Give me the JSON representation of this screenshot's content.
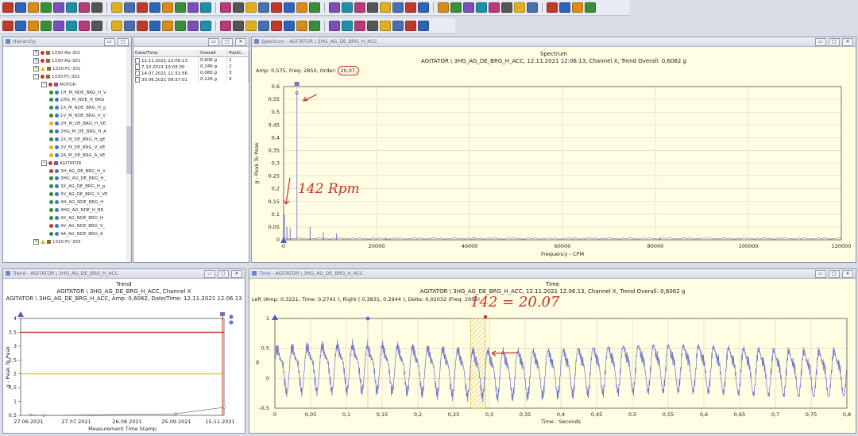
{
  "toolbar_icons_row1": [
    "app-icon",
    "open-icon",
    "save-icon",
    "print-icon",
    "chart-icon",
    "database-icon",
    "tools-icon",
    "report-icon",
    "export-icon",
    "settings-icon",
    "zoom-in-icon",
    "zoom-out-icon",
    "home-icon",
    "hand-icon",
    "target-icon"
  ],
  "toolbar_icons_row2": [
    "layout-icon",
    "grid-icon",
    "filter-icon",
    "cursor-icon",
    "spectrum-icon",
    "waveform-icon",
    "trend-icon",
    "orbit-icon",
    "bode-icon",
    "table-icon",
    "search-icon",
    "play-icon"
  ],
  "hierarchy": {
    "title": "Hierarchy",
    "nodes": [
      {
        "label": "1330-AG-301",
        "indent": 0,
        "status": "red",
        "kind": "machine"
      },
      {
        "label": "1330-AG-302",
        "indent": 0,
        "status": "red",
        "kind": "machine"
      },
      {
        "label": "1330-FC-301",
        "indent": 0,
        "status": "yellow",
        "kind": "machine"
      },
      {
        "label": "1330-FC-302",
        "indent": 0,
        "status": "red",
        "kind": "machine"
      },
      {
        "label": "MOTOR",
        "indent": 1,
        "status": "red",
        "kind": "component"
      },
      {
        "label": "1H_M_NDE_BRG_H_V",
        "indent": 2,
        "status": "green",
        "kind": "point"
      },
      {
        "label": "1HG_M_NDE_H_BRG",
        "indent": 2,
        "status": "green",
        "kind": "point"
      },
      {
        "label": "1X_M_NDE_BRG_H_g",
        "indent": 2,
        "status": "green",
        "kind": "point"
      },
      {
        "label": "1V_M_NDE_BRG_V_V",
        "indent": 2,
        "status": "green",
        "kind": "point"
      },
      {
        "label": "2H_M_DE_BRG_H_VE",
        "indent": 2,
        "status": "yellow",
        "kind": "point"
      },
      {
        "label": "2HG_M_DE_BRG_H_A",
        "indent": 2,
        "status": "green",
        "kind": "point"
      },
      {
        "label": "2X_M_DE_BRG_H_gE",
        "indent": 2,
        "status": "green",
        "kind": "point"
      },
      {
        "label": "2V_M_DE_BRG_V_VE",
        "indent": 2,
        "status": "yellow",
        "kind": "point"
      },
      {
        "label": "2A_M_DE_BRG_A_VE",
        "indent": 2,
        "status": "yellow",
        "kind": "point"
      },
      {
        "label": "AGITATOR",
        "indent": 1,
        "status": "red",
        "kind": "component"
      },
      {
        "label": "3H_AG_DE_BRG_H_V",
        "indent": 2,
        "status": "red",
        "kind": "point"
      },
      {
        "label": "3HG_AG_DE_BRG_H_",
        "indent": 2,
        "status": "green",
        "kind": "point"
      },
      {
        "label": "3X_AG_DE_BRG_H_g",
        "indent": 2,
        "status": "green",
        "kind": "point"
      },
      {
        "label": "3V_AG_DE_BRG_V_VE",
        "indent": 2,
        "status": "green",
        "kind": "point"
      },
      {
        "label": "4H_AG_NDE_BRG_H",
        "indent": 2,
        "status": "green",
        "kind": "point"
      },
      {
        "label": "4HG_AG_NDE_H_BR",
        "indent": 2,
        "status": "green",
        "kind": "point"
      },
      {
        "label": "4X_AG_NDE_BRG_H",
        "indent": 2,
        "status": "green",
        "kind": "point"
      },
      {
        "label": "4V_AG_NDE_BRG_V_",
        "indent": 2,
        "status": "red",
        "kind": "point"
      },
      {
        "label": "4A_AG_NDE_BRG_A",
        "indent": 2,
        "status": "green",
        "kind": "point"
      },
      {
        "label": "1330-FC-303",
        "indent": 0,
        "status": "yellow",
        "kind": "machine"
      }
    ]
  },
  "measurements": {
    "headers": [
      "Date/Time",
      "Overall",
      "Positi..."
    ],
    "rows": [
      {
        "date": "12.11.2021 12:06:13",
        "overall": "0,606 g",
        "pos": "1"
      },
      {
        "date": "7.10.2021 10:03:30",
        "overall": "0,246 g",
        "pos": "2"
      },
      {
        "date": "14.07.2021 11:31:56",
        "overall": "0,080 g",
        "pos": "3"
      },
      {
        "date": "30.06.2021 09:37:01",
        "overall": "0,126 g",
        "pos": "4"
      }
    ]
  },
  "spectrum": {
    "window_title": "Spectrum - AGITATOR \\ 3HG_AG_DE_BRG_H_ACC",
    "title": "Spectrum",
    "subtitle": "AGITATOR \\ 3HG_AG_DE_BRG_H_ACC, 12.11.2021 12:06:13, Channel X, Trend Overall: 0,6062 g",
    "cursor_readout_prefix": "Amp: 0,575, Freq: 2850, Order:",
    "cursor_readout_order": "20,07,",
    "ylabel": "g - Peak To Peak",
    "xlabel": "Frequency - CPM",
    "annotation": "142 Rpm"
  },
  "trend": {
    "window_title": "Trend - AGITATOR \\ 3HG_AG_DE_BRG_H_ACC",
    "title": "Trend",
    "subtitle": "AGITATOR \\ 3HG_AG_DE_BRG_H_ACC, Channel X",
    "subtitle2": "AGITATOR \\ 3HG_AG_DE_BRG_H_ACC, Amp: 0,6062, Date/Time: 12.11.2021 12.06.13",
    "ylabel": "g - Peak To Peak",
    "xlabel": "Measurement Time Stamp"
  },
  "time": {
    "window_title": "Time - AGITATOR \\ 3HG_AG_DE_BRG_H_ACC",
    "title": "Time",
    "subtitle": "AGITATOR \\ 3HG_AG_DE_BRG_H_ACC, 12.11.2021 12.06.13, Channel X, Trend Overall: 0,6062 g",
    "cursor_readout": "Left (Amp: 0,3221, Time: 0,2741 ), Right ( 0,3831, 0,2944 ), Delta: 0,02032 (Freq: 2953)",
    "ylabel": "g",
    "xlabel": "Time - Seconds",
    "annotation": "142 = 20.07"
  },
  "chart_data": [
    {
      "type": "line",
      "name": "spectrum",
      "xlabel": "Frequency - CPM",
      "ylabel": "g - Peak To Peak",
      "xlim": [
        0,
        120000
      ],
      "ylim": [
        0,
        0.6
      ],
      "xticks": [
        "0",
        "20000",
        "40000",
        "60000",
        "80000",
        "100000",
        "120000"
      ],
      "yticks": [
        "0",
        "0,05",
        "0,1",
        "0,15",
        "0,2",
        "0,25",
        "0,3",
        "0,35",
        "0,4",
        "0,45",
        "0,5",
        "0,55",
        "0,6"
      ],
      "peaks": [
        {
          "x": 142,
          "y": 0.1
        },
        {
          "x": 700,
          "y": 0.05
        },
        {
          "x": 1400,
          "y": 0.045
        },
        {
          "x": 2850,
          "y": 0.575
        },
        {
          "x": 5700,
          "y": 0.05
        },
        {
          "x": 8550,
          "y": 0.03
        },
        {
          "x": 11400,
          "y": 0.025
        },
        {
          "x": 22000,
          "y": 0.01
        },
        {
          "x": 41000,
          "y": 0.008
        },
        {
          "x": 81000,
          "y": 0.01
        }
      ],
      "grid": true
    },
    {
      "type": "line",
      "name": "trend",
      "xlabel": "Measurement Time Stamp",
      "ylabel": "g - Peak To Peak",
      "ylim": [
        0.5,
        4
      ],
      "xticks": [
        "27.06.2021",
        "27.07.2021",
        "26.08.2021",
        "25.09.2021",
        "15.11.2021"
      ],
      "yticks": [
        "0,5",
        "1",
        "1,5",
        "2",
        "2,5",
        "3",
        "3,5",
        "4"
      ],
      "points": [
        {
          "x": "30.06.2021",
          "y": 0.126
        },
        {
          "x": "14.07.2021",
          "y": 0.08
        },
        {
          "x": "7.10.2021",
          "y": 0.246
        },
        {
          "x": "12.11.2021",
          "y": 0.606
        }
      ],
      "alarm_levels": [
        {
          "level": "danger",
          "y": 3.5,
          "color": "#c0392b"
        },
        {
          "level": "alert",
          "y": 2.0,
          "color": "#e4d40a"
        }
      ]
    },
    {
      "type": "line",
      "name": "time waveform",
      "xlabel": "Time - Seconds",
      "ylabel": "g",
      "xlim": [
        0,
        0.8
      ],
      "ylim": [
        -0.5,
        1
      ],
      "xticks": [
        "0",
        "0,05",
        "0,1",
        "0,15",
        "0,2",
        "0,25",
        "0,3",
        "0,35",
        "0,4",
        "0,45",
        "0,5",
        "0,55",
        "0,6",
        "0,65",
        "0,7",
        "0,75",
        "0,8"
      ],
      "yticks": [
        "-0,5",
        "0",
        "0,5",
        "1"
      ],
      "dominant_freq_hz": 47.5,
      "cursor_band": [
        0.2741,
        0.2944
      ],
      "marker_x": 0.13
    }
  ],
  "colors": {
    "accent": "#3f5fb4",
    "plot_bg": "#fffde2",
    "signal": "#6b72c9",
    "annotation": "#c9302c",
    "alarm_red": "#c0392b",
    "alarm_yellow": "#e4d40a"
  }
}
